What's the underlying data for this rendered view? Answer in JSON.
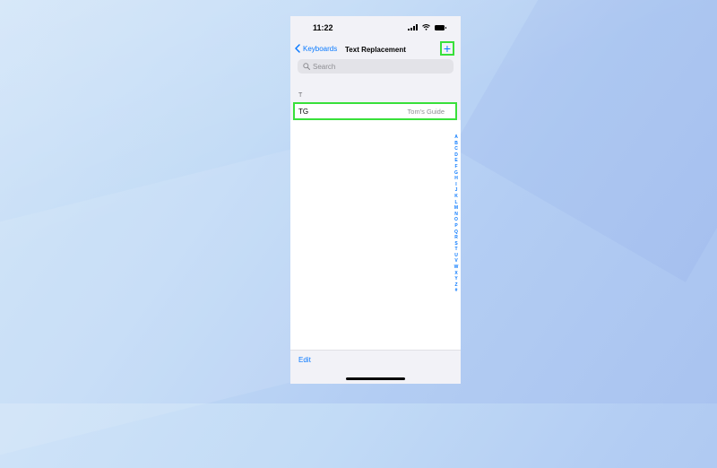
{
  "status_bar": {
    "time": "11:22"
  },
  "nav": {
    "back_label": "Keyboards",
    "title": "Text Replacement",
    "add_symbol": "+"
  },
  "search": {
    "placeholder": "Search"
  },
  "section": {
    "header": "T"
  },
  "rows": [
    {
      "shortcut": "TG",
      "phrase": "Tom's Guide"
    }
  ],
  "index_letters": [
    "A",
    "B",
    "C",
    "D",
    "E",
    "F",
    "G",
    "H",
    "I",
    "J",
    "K",
    "L",
    "M",
    "N",
    "O",
    "P",
    "Q",
    "R",
    "S",
    "T",
    "U",
    "V",
    "W",
    "X",
    "Y",
    "Z",
    "#"
  ],
  "toolbar": {
    "edit_label": "Edit"
  },
  "colors": {
    "accent": "#0a7aff",
    "highlight": "#38e03a"
  }
}
